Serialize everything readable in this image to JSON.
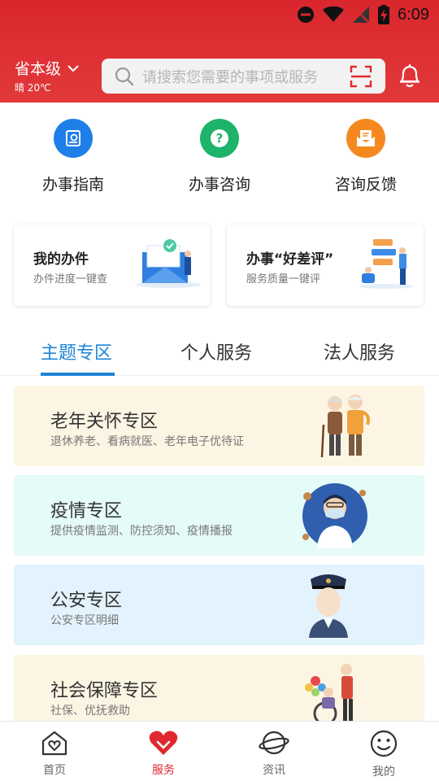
{
  "status_bar": {
    "time": "6:09"
  },
  "header": {
    "region": "省本级",
    "weather": "晴 20℃",
    "search_placeholder": "请搜索您需要的事项或服务"
  },
  "quick_actions": [
    {
      "label": "办事指南",
      "icon": "guide-book-icon",
      "color": "#1e7fe8"
    },
    {
      "label": "办事咨询",
      "icon": "question-icon",
      "color": "#1db36a"
    },
    {
      "label": "咨询反馈",
      "icon": "feedback-mail-icon",
      "color": "#f5891f"
    }
  ],
  "cards": [
    {
      "title": "我的办件",
      "subtitle": "办件进度一键查"
    },
    {
      "title": "办事“好差评”",
      "subtitle": "服务质量一键评"
    }
  ],
  "tabs": [
    {
      "label": "主题专区",
      "active": true
    },
    {
      "label": "个人服务",
      "active": false
    },
    {
      "label": "法人服务",
      "active": false
    }
  ],
  "zones": [
    {
      "title": "老年关怀专区",
      "subtitle": "退休养老、看病就医、老年电子优待证",
      "bg": "#fdf5e4"
    },
    {
      "title": "疫情专区",
      "subtitle": "提供疫情监测、防控须知、疫情播报",
      "bg": "#e4fbf8"
    },
    {
      "title": "公安专区",
      "subtitle": "公安专区明细",
      "bg": "#e3f3fd"
    },
    {
      "title": "社会保障专区",
      "subtitle": "社保、优抚救助",
      "bg": "#fdf5e4"
    }
  ],
  "tabbar": [
    {
      "label": "首页",
      "icon": "home-heart-icon",
      "active": false
    },
    {
      "label": "服务",
      "icon": "heart-icon",
      "active": true
    },
    {
      "label": "资讯",
      "icon": "planet-icon",
      "active": false
    },
    {
      "label": "我的",
      "icon": "smiley-icon",
      "active": false
    }
  ],
  "colors": {
    "header": "#d9262d",
    "accent_blue": "#1d84d6",
    "active_red": "#e0282e"
  }
}
